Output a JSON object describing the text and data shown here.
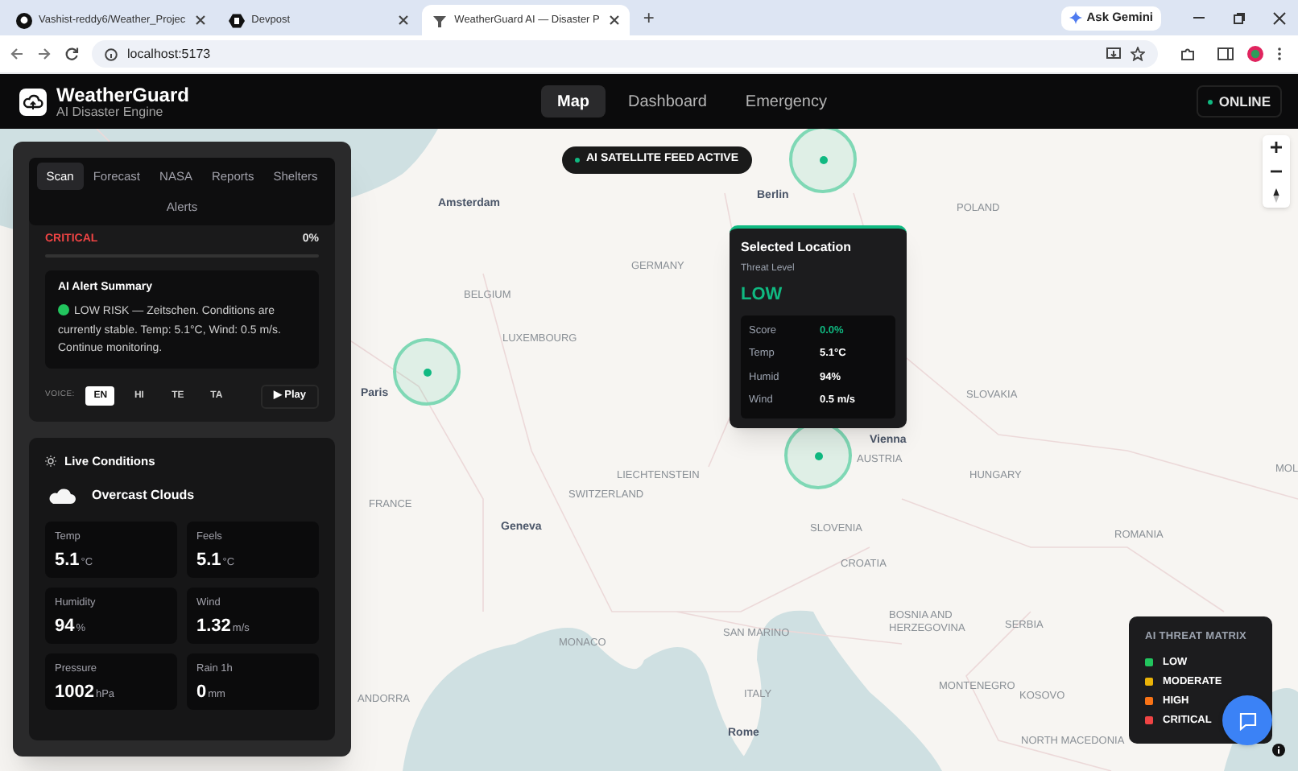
{
  "browser": {
    "tabs": [
      {
        "title": "Vashist-reddy6/Weather_Projec",
        "selected": false
      },
      {
        "title": "Devpost",
        "selected": false
      },
      {
        "title": "WeatherGuard AI — Disaster P",
        "selected": true
      }
    ],
    "new_tab": "+",
    "gemini": "Ask Gemini",
    "url": "localhost:5173"
  },
  "header": {
    "title": "WeatherGuard",
    "subtitle": "AI Disaster Engine",
    "nav": [
      {
        "label": "Map",
        "selected": true
      },
      {
        "label": "Dashboard",
        "selected": false
      },
      {
        "label": "Emergency",
        "selected": false
      }
    ],
    "status": "ONLINE"
  },
  "panel": {
    "tabs": [
      {
        "label": "Scan",
        "selected": true
      },
      {
        "label": "Forecast",
        "selected": false
      },
      {
        "label": "NASA",
        "selected": false
      },
      {
        "label": "Reports",
        "selected": false
      },
      {
        "label": "Shelters",
        "selected": false
      },
      {
        "label": "Alerts",
        "selected": false
      }
    ],
    "risk": {
      "label": "CRITICAL",
      "value": "0%",
      "level": 0
    },
    "summary": {
      "title": "AI Alert Summary",
      "color": "#22c55e",
      "text": "LOW RISK — Zeitschen. Conditions are currently stable. Temp: 5.1°C, Wind: 0.5 m/s. Continue monitoring."
    },
    "voice": {
      "label": "VOICE:",
      "languages": [
        {
          "label": "EN",
          "selected": true
        },
        {
          "label": "HI",
          "selected": false
        },
        {
          "label": "TE",
          "selected": false
        },
        {
          "label": "TA",
          "selected": false
        }
      ],
      "play": "▶ Play"
    }
  },
  "conditions": {
    "title": "Live Conditions",
    "weather": "Overcast Clouds",
    "stats": [
      {
        "label": "Temp",
        "value": "5.1",
        "unit": "°C"
      },
      {
        "label": "Feels",
        "value": "5.1",
        "unit": "°C"
      },
      {
        "label": "Humidity",
        "value": "94",
        "unit": "%"
      },
      {
        "label": "Wind",
        "value": "1.32",
        "unit": "m/s"
      },
      {
        "label": "Pressure",
        "value": "1002",
        "unit": "hPa"
      },
      {
        "label": "Rain 1h",
        "value": "0",
        "unit": "mm"
      }
    ]
  },
  "map": {
    "badge": "AI SATELLITE FEED ACTIVE",
    "labels": [
      {
        "text": "Amsterdam",
        "kind": "city"
      },
      {
        "text": "Berlin",
        "kind": "city"
      },
      {
        "text": "GERMANY",
        "kind": "country"
      },
      {
        "text": "POLAND",
        "kind": "country"
      },
      {
        "text": "BELGIUM",
        "kind": "country"
      },
      {
        "text": "LUXEMBOURG",
        "kind": "country"
      },
      {
        "text": "Paris",
        "kind": "city"
      },
      {
        "text": "FRANCE",
        "kind": "country"
      },
      {
        "text": "LIECHTENSTEIN",
        "kind": "country"
      },
      {
        "text": "SWITZERLAND",
        "kind": "country"
      },
      {
        "text": "Geneva",
        "kind": "city"
      },
      {
        "text": "Vienna",
        "kind": "city"
      },
      {
        "text": "AUSTRIA",
        "kind": "country"
      },
      {
        "text": "SLOVAKIA",
        "kind": "country"
      },
      {
        "text": "HUNGARY",
        "kind": "country"
      },
      {
        "text": "SLOVENIA",
        "kind": "country"
      },
      {
        "text": "CROATIA",
        "kind": "country"
      },
      {
        "text": "ROMANIA",
        "kind": "country"
      },
      {
        "text": "BOSNIA AND HERZEGOVINA",
        "kind": "country"
      },
      {
        "text": "SERBIA",
        "kind": "country"
      },
      {
        "text": "MONTENEGRO",
        "kind": "country"
      },
      {
        "text": "KOSOVO",
        "kind": "country"
      },
      {
        "text": "NORTH MACEDONIA",
        "kind": "country"
      },
      {
        "text": "SAN MARINO",
        "kind": "country"
      },
      {
        "text": "MONACO",
        "kind": "country"
      },
      {
        "text": "ITALY",
        "kind": "country"
      },
      {
        "text": "ANDORRA",
        "kind": "country"
      },
      {
        "text": "Rome",
        "kind": "city"
      },
      {
        "text": "MOL",
        "kind": "country"
      }
    ],
    "popup": {
      "title": "Selected Location",
      "subtitle": "Threat Level",
      "level": "LOW",
      "rows": [
        {
          "label": "Score",
          "value": "0.0%",
          "kind": "score"
        },
        {
          "label": "Temp",
          "value": "5.1°C",
          "kind": "plain"
        },
        {
          "label": "Humid",
          "value": "94%",
          "kind": "plain"
        },
        {
          "label": "Wind",
          "value": "0.5 m/s",
          "kind": "plain"
        }
      ]
    },
    "legend": {
      "title": "AI THREAT MATRIX",
      "items": [
        {
          "label": "LOW",
          "color": "#22c55e"
        },
        {
          "label": "MODERATE",
          "color": "#eab308"
        },
        {
          "label": "HIGH",
          "color": "#f97316"
        },
        {
          "label": "CRITICAL",
          "color": "#ef4444"
        }
      ]
    }
  }
}
